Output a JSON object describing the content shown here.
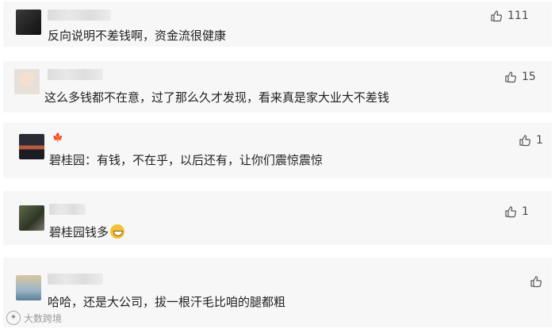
{
  "comments": [
    {
      "text": "反向说明不差钱啊，资金流很健康",
      "likes": "111"
    },
    {
      "text": "这么多钱都不在意，过了那么久才发现，看来真是家大业大不差钱",
      "likes": "15"
    },
    {
      "text": "碧桂园：有钱，不在乎，以后还有，让你们震惊震惊",
      "likes": "1"
    },
    {
      "text": "碧桂园钱多",
      "likes": "1"
    },
    {
      "text": "哈哈，还是大公司，拔一根汗毛比咱的腿都粗",
      "likes": ""
    }
  ],
  "watermark": {
    "text": "大数跨境",
    "icon": "globe-icon"
  },
  "colors": {
    "card_bg": "#f7f7f7",
    "text": "#1f1f1f",
    "like": "#4a4a4a"
  }
}
